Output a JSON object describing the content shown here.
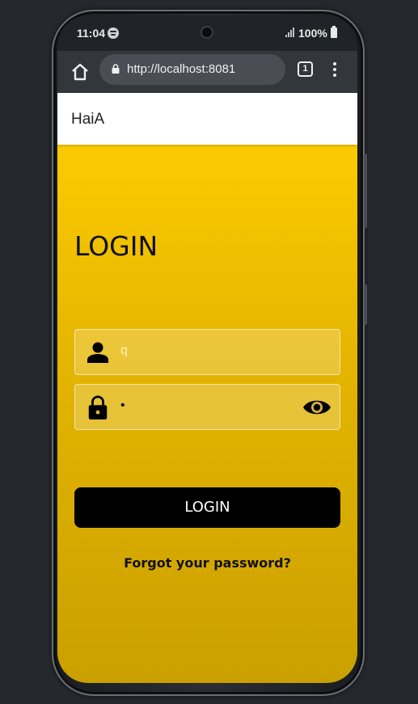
{
  "status_bar": {
    "time": "11:04",
    "battery": "100%"
  },
  "browser": {
    "url": "http://localhost:8081",
    "tab_count": "1"
  },
  "app": {
    "brand": "HaiA"
  },
  "login": {
    "title": "LOGIN",
    "username_value": "q",
    "password_value": "•",
    "button_label": "LOGIN",
    "forgot_label": "Forgot your password?"
  },
  "colors": {
    "accent": "#fbcb00",
    "accent_dark": "#caa000",
    "button": "#000000"
  },
  "icons": [
    "home-icon",
    "lock-icon",
    "tabs-icon",
    "more-menu-icon",
    "user-icon",
    "padlock-icon",
    "eye-icon",
    "spotify-icon",
    "signal-icon",
    "battery-icon"
  ]
}
